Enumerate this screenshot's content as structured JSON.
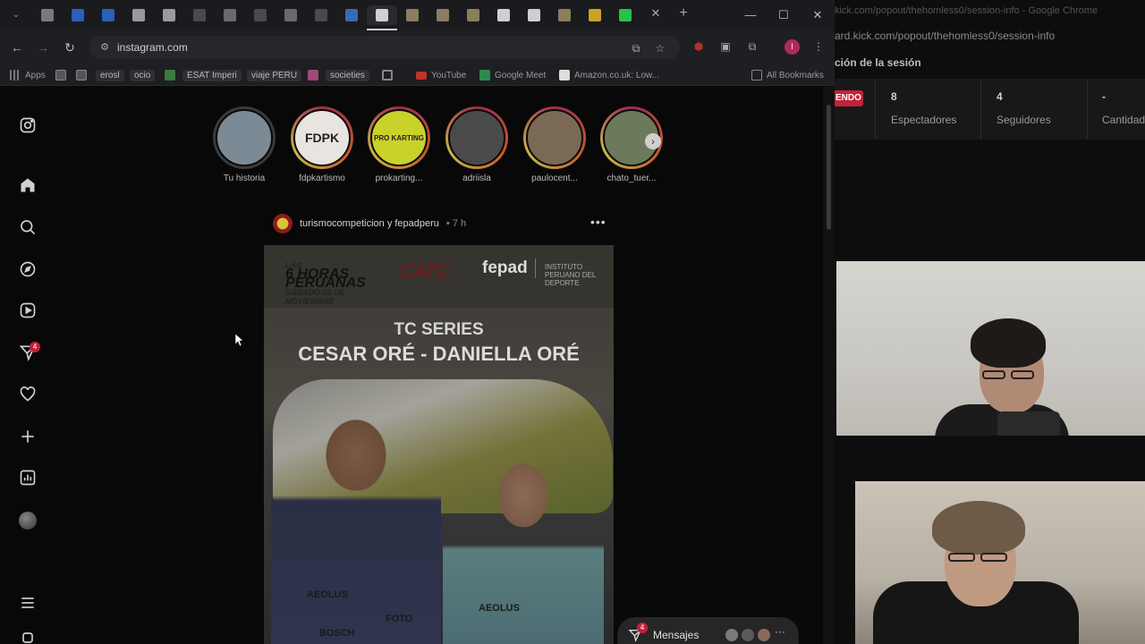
{
  "browser": {
    "url": "instagram.com",
    "tabs": [
      {
        "icon": "bell-icon",
        "color": "#7a7a7a"
      },
      {
        "icon": "word-icon",
        "color": "#2b5fb8"
      },
      {
        "icon": "word-icon",
        "color": "#2b5fb8"
      },
      {
        "icon": "chatgpt-icon",
        "color": "#9a9a9a"
      },
      {
        "icon": "spiral-icon",
        "color": "#9a9a9a"
      },
      {
        "icon": "blank-icon",
        "color": "#4a4a4a"
      },
      {
        "icon": "r-icon",
        "color": "#6a6a6a"
      },
      {
        "icon": "blank-icon",
        "color": "#4a4a4a"
      },
      {
        "icon": "r-icon",
        "color": "#6a6a6a"
      },
      {
        "icon": "blank-icon",
        "color": "#4a4a4a"
      },
      {
        "icon": "translate-icon",
        "color": "#3a6ab0"
      },
      {
        "icon": "page-icon",
        "color": "#d0d0d0"
      },
      {
        "icon": "page-icon",
        "color": "#8a7e5e"
      },
      {
        "icon": "page-icon",
        "color": "#8a7e5e"
      },
      {
        "icon": "page-icon",
        "color": "#8a7e5e"
      },
      {
        "icon": "amazon-icon",
        "color": "#cfcfcf"
      },
      {
        "icon": "amazon-icon",
        "color": "#cfcfcf"
      },
      {
        "icon": "page-icon",
        "color": "#8a7e5e"
      },
      {
        "icon": "gmail-icon",
        "color": "#c9a227"
      },
      {
        "icon": "kick-icon",
        "color": "#27c24c"
      }
    ],
    "bookmarks": {
      "apps": "Apps",
      "erosl": "erosl",
      "ocio": "ocio",
      "esat": "ESAT Imperi",
      "viaje": "viaje PERU",
      "societies": "societies",
      "youtube": "YouTube",
      "meet": "Google Meet",
      "amazon": "Amazon.co.uk: Low...",
      "all": "All Bookmarks"
    },
    "profile_initial": "I"
  },
  "instagram": {
    "notif_count": "4",
    "stories": [
      {
        "name": "Tu historia",
        "seen": true,
        "color": "#7c8a96"
      },
      {
        "name": "fdpkartismo",
        "seen": false,
        "color": "#e8e4e0",
        "label": "FDPK"
      },
      {
        "name": "prokarting...",
        "seen": false,
        "color": "#c9d22a",
        "label": "PRO KARTING"
      },
      {
        "name": "adriisla",
        "seen": false,
        "color": "#4a4a4a"
      },
      {
        "name": "paulocent...",
        "seen": false,
        "color": "#7a6a55"
      },
      {
        "name": "chato_tuer...",
        "seen": false,
        "color": "#6a7a5a"
      }
    ],
    "post": {
      "user": "turismocompeticion y fepadperu",
      "time": "• 7 h",
      "logo_line1": "LAS",
      "logo_line2": "6 HORAS PERUANAS",
      "logo_line3": "SÁBADO 29 DE NOVIEMBRE",
      "logo_catc": "CATC",
      "logo_fepad": "fepad",
      "logo_ipd": "INSTITUTO PERUANO DEL DEPORTE",
      "title1": "TC SERIES",
      "title2": "CESAR ORÉ - DANIELLA ORÉ",
      "sponsor1": "AEOLUS",
      "sponsor2": "FOTO",
      "sponsor3": "BOSCH",
      "sponsor4": "AEOLUS"
    },
    "messages": {
      "label": "Mensajes",
      "count": "4"
    }
  },
  "kick_panel": {
    "window_title": "kick.com/popout/thehomless0/session-info - Google Chrome",
    "url": "ard.kick.com/popout/thehomless0/session-info",
    "heading": "ción de la sesión",
    "live_badge": "ENDO",
    "stats": [
      {
        "value": "8",
        "label": "Espectadores"
      },
      {
        "value": "4",
        "label": "Seguidores"
      },
      {
        "value": "-",
        "label": "Cantidad suscrip"
      }
    ]
  }
}
